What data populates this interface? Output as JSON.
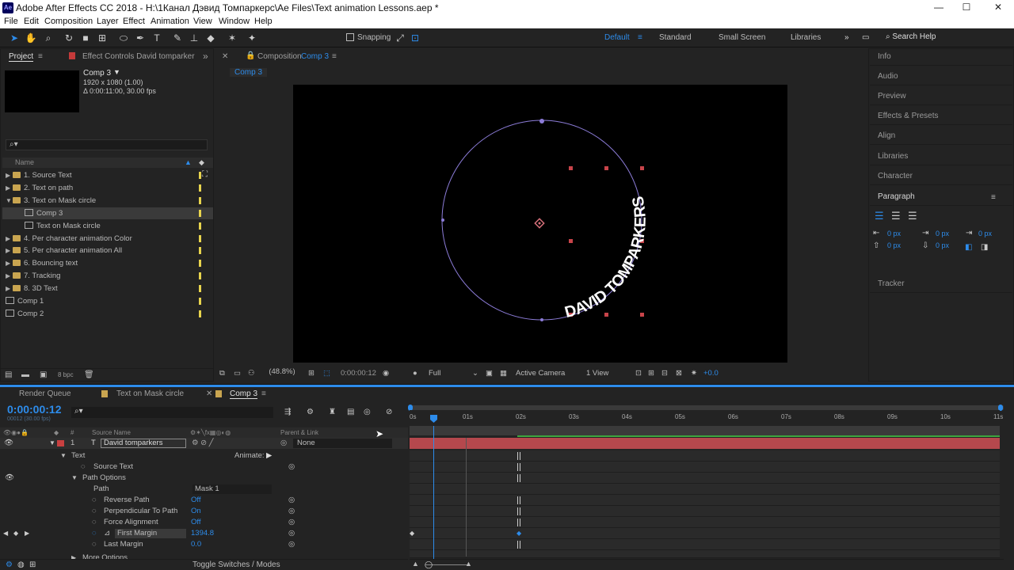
{
  "title": "Adobe After Effects CC 2018 - H:\\1Канал Дэвид Томпаркерс\\Ae Files\\Text animation Lessons.aep *",
  "app_icon": "Ae",
  "window_controls": {
    "minimize": "—",
    "maximize": "☐",
    "close": "✕"
  },
  "menu": [
    "File",
    "Edit",
    "Composition",
    "Layer",
    "Effect",
    "Animation",
    "View",
    "Window",
    "Help"
  ],
  "toolbar": {
    "snapping": "Snapping"
  },
  "workspaces": [
    "Default",
    "Standard",
    "Small Screen",
    "Libraries"
  ],
  "search_help": "Search Help",
  "project_panel": {
    "tab_project": "Project",
    "tab_effects": "Effect Controls David tomparker",
    "comp_name": "Comp 3",
    "comp_res": "1920 x 1080 (1.00)",
    "comp_dur": "Δ 0:00:11:00, 30.00 fps",
    "search": "⌕▾",
    "col_name": "Name",
    "items": [
      {
        "label": "1. Source Text",
        "type": "folder"
      },
      {
        "label": "2. Text on path",
        "type": "folder"
      },
      {
        "label": "3. Text on Mask circle",
        "type": "folder-open"
      },
      {
        "label": "Comp 3",
        "type": "comp",
        "indent": true,
        "selected": true
      },
      {
        "label": "Text on Mask circle",
        "type": "comp",
        "indent": true
      },
      {
        "label": "4. Per character animation Color",
        "type": "folder"
      },
      {
        "label": "5. Per character animation All",
        "type": "folder"
      },
      {
        "label": "6. Bouncing text",
        "type": "folder"
      },
      {
        "label": "7. Tracking",
        "type": "folder"
      },
      {
        "label": "8. 3D Text",
        "type": "folder"
      },
      {
        "label": "Comp 1",
        "type": "comp"
      },
      {
        "label": "Comp 2",
        "type": "comp"
      }
    ],
    "bpc": "8 bpc"
  },
  "composition": {
    "tab_label": "Composition",
    "tab_comp": "Comp 3",
    "subtab": "Comp 3",
    "canvas_text": "DAVID TOMPARKERS",
    "zoom": "(48.8%)",
    "time": "0:00:00:12",
    "resolution": "Full",
    "camera": "Active Camera",
    "views": "1 View",
    "exposure": "+0.0"
  },
  "right_panels": [
    "Info",
    "Audio",
    "Preview",
    "Effects & Presets",
    "Align",
    "Libraries",
    "Character",
    "Paragraph",
    "Tracker"
  ],
  "paragraph": {
    "v1": "0 px",
    "v2": "0 px",
    "v3": "0 px",
    "v4": "0 px",
    "v5": "0 px"
  },
  "timeline": {
    "tabs": [
      "Render Queue",
      "Text on Mask circle",
      "Comp 3"
    ],
    "timecode": "0:00:00:12",
    "subtimecode": "00012 (30.00 fps)",
    "col_source": "Source Name",
    "col_parent": "Parent & Link",
    "layer_num": "1",
    "layer_name": "David tomparkers",
    "parent": "None",
    "text_group": "Text",
    "animate": "Animate:",
    "source_text": "Source Text",
    "path_options": "Path Options",
    "path": "Path",
    "path_value": "Mask 1",
    "reverse_path": "Reverse Path",
    "reverse_path_val": "Off",
    "perp_path": "Perpendicular To Path",
    "perp_path_val": "On",
    "force_align": "Force Alignment",
    "force_align_val": "Off",
    "first_margin": "First Margin",
    "first_margin_val": "1394.8",
    "last_margin": "Last Margin",
    "last_margin_val": "0.0",
    "more_options": "More Options",
    "toggle": "Toggle Switches / Modes",
    "ruler": [
      "0s",
      "01s",
      "02s",
      "03s",
      "04s",
      "05s",
      "06s",
      "07s",
      "08s",
      "09s",
      "10s",
      "11s"
    ]
  }
}
